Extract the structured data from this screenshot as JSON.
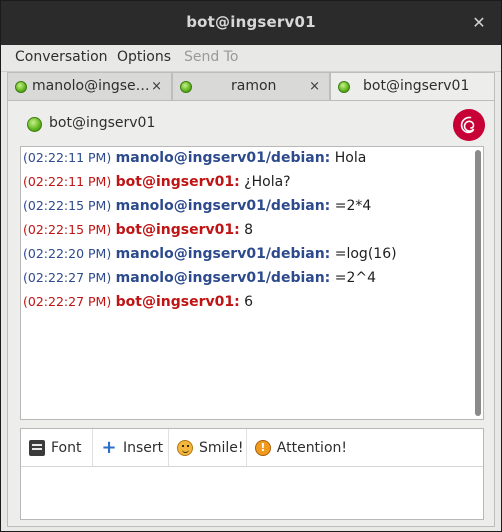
{
  "window": {
    "title": "bot@ingserv01",
    "close_glyph": "✕"
  },
  "menu": [
    {
      "label": "Conversation",
      "enabled": true
    },
    {
      "label": "Options",
      "enabled": true
    },
    {
      "label": "Send To",
      "enabled": false
    }
  ],
  "tabs": [
    {
      "label": "manolo@ingse…",
      "close": "×",
      "active": false
    },
    {
      "label": "ramon",
      "close": "×",
      "active": false
    },
    {
      "label": "bot@ingserv01",
      "close": "",
      "active": true
    }
  ],
  "contact": {
    "name": "bot@ingserv01",
    "status_color": "#5fb51d",
    "logo": "debian-logo"
  },
  "messages": [
    {
      "time": "(02:22:11 PM)",
      "sender": "manolo@ingserv01/debian:",
      "text": "Hola",
      "direction": "in"
    },
    {
      "time": "(02:22:11 PM)",
      "sender": "bot@ingserv01:",
      "text": "¿Hola?",
      "direction": "out"
    },
    {
      "time": "(02:22:15 PM)",
      "sender": "manolo@ingserv01/debian:",
      "text": "=2*4",
      "direction": "in"
    },
    {
      "time": "(02:22:15 PM)",
      "sender": "bot@ingserv01:",
      "text": "8",
      "direction": "out"
    },
    {
      "time": "(02:22:20 PM)",
      "sender": "manolo@ingserv01/debian:",
      "text": "=log(16)",
      "direction": "in"
    },
    {
      "time": "(02:22:27 PM)",
      "sender": "manolo@ingserv01/debian:",
      "text": "=2^4",
      "direction": "in"
    },
    {
      "time": "(02:22:27 PM)",
      "sender": "bot@ingserv01:",
      "text": "6",
      "direction": "out"
    }
  ],
  "toolbar": {
    "font_label": "Font",
    "insert_label": "Insert",
    "smile_label": "Smile!",
    "attention_label": "Attention!",
    "attention_glyph": "!",
    "insert_glyph": "+"
  },
  "colors": {
    "incoming": "#2c4a8c",
    "outgoing": "#c01414",
    "titlebar": "#2b2b2b",
    "accent_green": "#5fb51d",
    "debian_red": "#c70036"
  }
}
